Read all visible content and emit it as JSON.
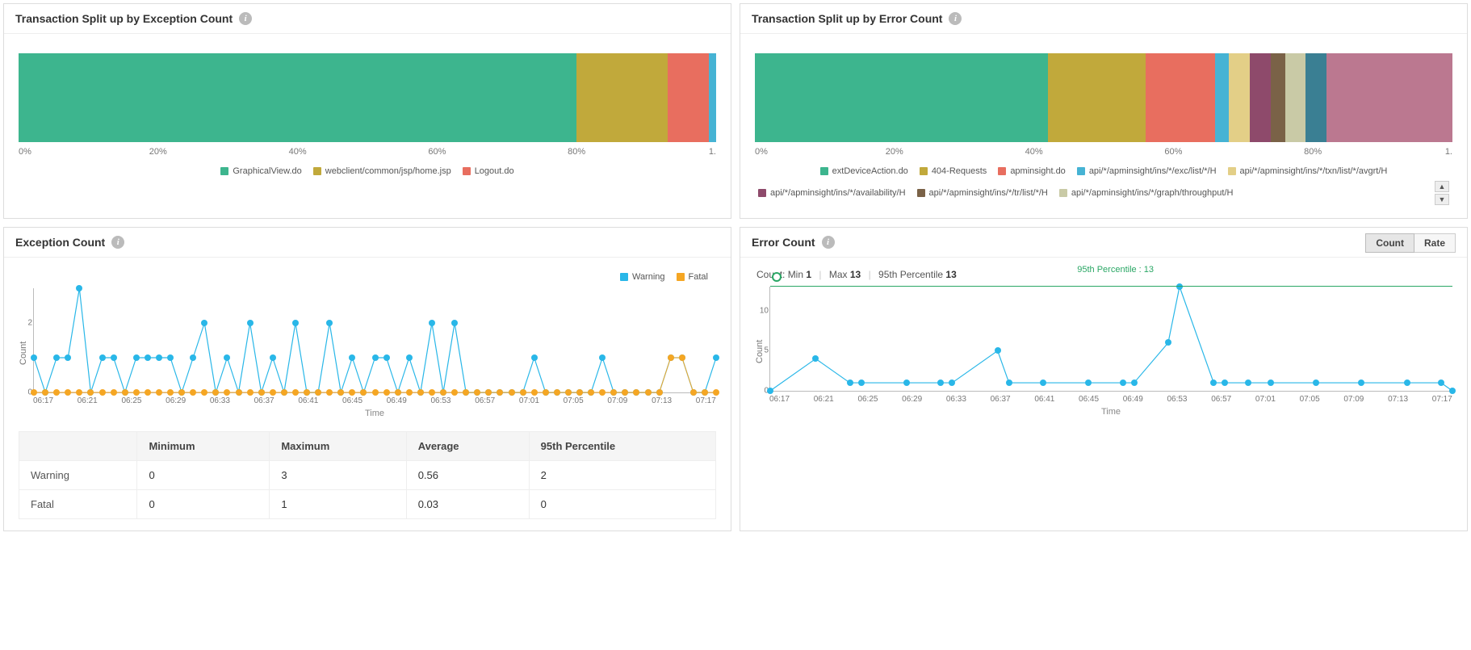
{
  "palette": {
    "green": "#3db58e",
    "olive": "#c1a93b",
    "red": "#e86e5f",
    "cyan": "#46b3d4",
    "tan": "#e3cf87",
    "plum": "#8e4a6b",
    "brown": "#7a6247",
    "sage": "#c9caa6",
    "teal": "#3a7f93",
    "rose": "#bb7890",
    "seriesWarn": "#29b7e8",
    "seriesFatal": "#f5a623",
    "percentile": "#2aa765"
  },
  "panels": {
    "exSplit": {
      "title": "Transaction Split up by Exception Count",
      "chart_data": {
        "type": "bar",
        "orientation": "hstacked",
        "ticks": [
          "0%",
          "20%",
          "40%",
          "60%",
          "80%",
          "1."
        ],
        "series": [
          {
            "name": "GraphicalView.do",
            "color": "green",
            "pct": 80
          },
          {
            "name": "webclient/common/jsp/home.jsp",
            "color": "olive",
            "pct": 13
          },
          {
            "name": "Logout.do",
            "color": "red",
            "pct": 6
          },
          {
            "name": "",
            "color": "cyan",
            "pct": 1
          }
        ]
      }
    },
    "errSplit": {
      "title": "Transaction Split up by Error Count",
      "chart_data": {
        "type": "bar",
        "orientation": "hstacked",
        "ticks": [
          "0%",
          "20%",
          "40%",
          "60%",
          "80%",
          "1."
        ],
        "hasScroll": true,
        "series": [
          {
            "name": "extDeviceAction.do",
            "color": "green",
            "pct": 42
          },
          {
            "name": "404-Requests",
            "color": "olive",
            "pct": 14
          },
          {
            "name": "apminsight.do",
            "color": "red",
            "pct": 10
          },
          {
            "name": "api/*/apminsight/ins/*/exc/list/*/H",
            "color": "cyan",
            "pct": 2
          },
          {
            "name": "api/*/apminsight/ins/*/txn/list/*/avgrt/H",
            "color": "tan",
            "pct": 3
          },
          {
            "name": "api/*/apminsight/ins/*/availability/H",
            "color": "plum",
            "pct": 3
          },
          {
            "name": "api/*/apminsight/ins/*/tr/list/*/H",
            "color": "brown",
            "pct": 2
          },
          {
            "name": "api/*/apminsight/ins/*/graph/throughput/H",
            "color": "sage",
            "pct": 3
          },
          {
            "name": "",
            "color": "teal",
            "pct": 3
          },
          {
            "name": "",
            "color": "rose",
            "pct": 18
          }
        ]
      }
    },
    "exCount": {
      "title": "Exception Count",
      "legend": [
        {
          "name": "Warning",
          "colorKey": "seriesWarn"
        },
        {
          "name": "Fatal",
          "colorKey": "seriesFatal"
        }
      ],
      "chart_data": {
        "type": "line",
        "xlabel": "Time",
        "ylabel": "Count",
        "ylim": [
          0,
          3
        ],
        "yticks": [
          0,
          2
        ],
        "x": [
          "06:17",
          "06:18",
          "06:19",
          "06:20",
          "06:21",
          "06:22",
          "06:23",
          "06:24",
          "06:25",
          "06:26",
          "06:27",
          "06:28",
          "06:29",
          "06:30",
          "06:31",
          "06:32",
          "06:33",
          "06:34",
          "06:35",
          "06:36",
          "06:37",
          "06:38",
          "06:39",
          "06:40",
          "06:41",
          "06:42",
          "06:43",
          "06:44",
          "06:45",
          "06:46",
          "06:47",
          "06:48",
          "06:49",
          "06:50",
          "06:51",
          "06:52",
          "06:53",
          "06:54",
          "06:55",
          "06:56",
          "06:57",
          "06:58",
          "06:59",
          "07:00",
          "07:01",
          "07:02",
          "07:03",
          "07:04",
          "07:05",
          "07:06",
          "07:07",
          "07:08",
          "07:09",
          "07:10",
          "07:11",
          "07:12",
          "07:13",
          "07:14",
          "07:15",
          "07:16",
          "07:17"
        ],
        "xTicksEvery": 4,
        "series": [
          {
            "name": "Warning",
            "colorKey": "seriesWarn",
            "values": [
              1,
              0,
              1,
              1,
              3,
              0,
              1,
              1,
              0,
              1,
              1,
              1,
              1,
              0,
              1,
              2,
              0,
              1,
              0,
              2,
              0,
              1,
              0,
              2,
              0,
              0,
              2,
              0,
              1,
              0,
              1,
              1,
              0,
              1,
              0,
              2,
              0,
              2,
              0,
              0,
              0,
              0,
              0,
              0,
              1,
              0,
              0,
              0,
              0,
              0,
              1,
              0,
              0,
              0,
              0,
              0,
              1,
              1,
              0,
              0,
              1
            ]
          },
          {
            "name": "Fatal",
            "colorKey": "seriesFatal",
            "values": [
              0,
              0,
              0,
              0,
              0,
              0,
              0,
              0,
              0,
              0,
              0,
              0,
              0,
              0,
              0,
              0,
              0,
              0,
              0,
              0,
              0,
              0,
              0,
              0,
              0,
              0,
              0,
              0,
              0,
              0,
              0,
              0,
              0,
              0,
              0,
              0,
              0,
              0,
              0,
              0,
              0,
              0,
              0,
              0,
              0,
              0,
              0,
              0,
              0,
              0,
              0,
              0,
              0,
              0,
              0,
              0,
              1,
              1,
              0,
              0,
              0
            ]
          }
        ]
      },
      "table": {
        "headers": [
          "",
          "Minimum",
          "Maximum",
          "Average",
          "95th Percentile"
        ],
        "rows": [
          [
            "Warning",
            "0",
            "3",
            "0.56",
            "2"
          ],
          [
            "Fatal",
            "0",
            "1",
            "0.03",
            "0"
          ]
        ]
      }
    },
    "errCount": {
      "title": "Error Count",
      "tabs": [
        "Count",
        "Rate"
      ],
      "activeTab": 0,
      "statsLine": {
        "label": "Count:",
        "parts": [
          [
            "Min",
            "1"
          ],
          [
            "Max",
            "13"
          ],
          [
            "95th Percentile",
            "13"
          ]
        ]
      },
      "percentile": {
        "label": "95th Percentile : 13",
        "value": 13
      },
      "chart_data": {
        "type": "line",
        "xlabel": "Time",
        "ylabel": "Count",
        "ylim": [
          0,
          13
        ],
        "yticks": [
          0,
          5,
          10
        ],
        "x": [
          "06:17",
          "06:21",
          "06:24",
          "06:25",
          "06:29",
          "06:32",
          "06:33",
          "06:37",
          "06:38",
          "06:41",
          "06:45",
          "06:48",
          "06:49",
          "06:52",
          "06:53",
          "06:56",
          "06:57",
          "06:59",
          "07:01",
          "07:05",
          "07:09",
          "07:13",
          "07:16",
          "07:17"
        ],
        "xTicks": [
          "06:17",
          "06:21",
          "06:25",
          "06:29",
          "06:33",
          "06:37",
          "06:41",
          "06:45",
          "06:49",
          "06:53",
          "06:57",
          "07:01",
          "07:05",
          "07:09",
          "07:13",
          "07:17"
        ],
        "series": [
          {
            "name": "Count",
            "colorKey": "seriesWarn",
            "values": [
              0,
              4,
              1,
              1,
              1,
              1,
              1,
              5,
              1,
              1,
              1,
              1,
              1,
              6,
              13,
              1,
              1,
              1,
              1,
              1,
              1,
              1,
              1,
              0
            ]
          }
        ]
      }
    }
  }
}
